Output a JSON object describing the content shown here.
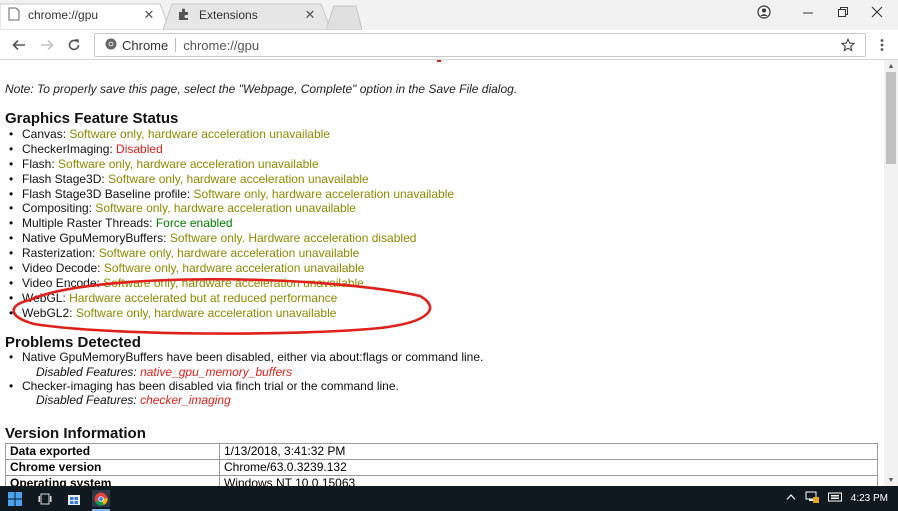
{
  "tabs": [
    {
      "title": "chrome://gpu",
      "icon": "page-icon",
      "active": true
    },
    {
      "title": "Extensions",
      "icon": "puzzle-icon",
      "active": false
    }
  ],
  "toolbar": {
    "site_chip": "Chrome",
    "url": "chrome://gpu"
  },
  "content": {
    "note": "Note: To properly save this page, select the \"Webpage, Complete\" option in the Save File dialog.",
    "feature_status_heading": "Graphics Feature Status",
    "features": [
      {
        "name": "Canvas",
        "status": "Software only, hardware acceleration unavailable",
        "color": "#8c8a00"
      },
      {
        "name": "CheckerImaging",
        "status": "Disabled",
        "color": "#e0201b"
      },
      {
        "name": "Flash",
        "status": "Software only, hardware acceleration unavailable",
        "color": "#8c8a00"
      },
      {
        "name": "Flash Stage3D",
        "status": "Software only, hardware acceleration unavailable",
        "color": "#8c8a00"
      },
      {
        "name": "Flash Stage3D Baseline profile",
        "status": "Software only, hardware acceleration unavailable",
        "color": "#8c8a00"
      },
      {
        "name": "Compositing",
        "status": "Software only, hardware acceleration unavailable",
        "color": "#8c8a00"
      },
      {
        "name": "Multiple Raster Threads",
        "status": "Force enabled",
        "color": "#008000"
      },
      {
        "name": "Native GpuMemoryBuffers",
        "status": "Software only. Hardware acceleration disabled",
        "color": "#8c8a00"
      },
      {
        "name": "Rasterization",
        "status": "Software only, hardware acceleration unavailable",
        "color": "#8c8a00"
      },
      {
        "name": "Video Decode",
        "status": "Software only, hardware acceleration unavailable",
        "color": "#8c8a00"
      },
      {
        "name": "Video Encode",
        "status": "Software only, hardware acceleration unavailable",
        "color": "#8c8a00"
      },
      {
        "name": "WebGL",
        "status": "Hardware accelerated but at reduced performance",
        "color": "#8c8a00"
      },
      {
        "name": "WebGL2",
        "status": "Software only, hardware acceleration unavailable",
        "color": "#8c8a00"
      }
    ],
    "problems_heading": "Problems Detected",
    "problems": [
      {
        "text": "Native GpuMemoryBuffers have been disabled, either via about:flags or command line.",
        "disabled_label": "Disabled Features:",
        "feature": "native_gpu_memory_buffers"
      },
      {
        "text": "Checker-imaging has been disabled via finch trial or the command line.",
        "disabled_label": "Disabled Features:",
        "feature": "checker_imaging"
      }
    ],
    "version_heading": "Version Information",
    "version_rows": [
      {
        "key": "Data exported",
        "value": "1/13/2018, 3:41:32 PM"
      },
      {
        "key": "Chrome version",
        "value": "Chrome/63.0.3239.132"
      },
      {
        "key": "Operating system",
        "value": "Windows NT 10.0.15063"
      }
    ]
  },
  "taskbar": {
    "time": "4:23 PM"
  },
  "colors": {
    "software_only": "#8c8a00",
    "disabled": "#e0201b",
    "enabled": "#008000",
    "annotation": "#e0201b",
    "taskbar": "#101820"
  }
}
